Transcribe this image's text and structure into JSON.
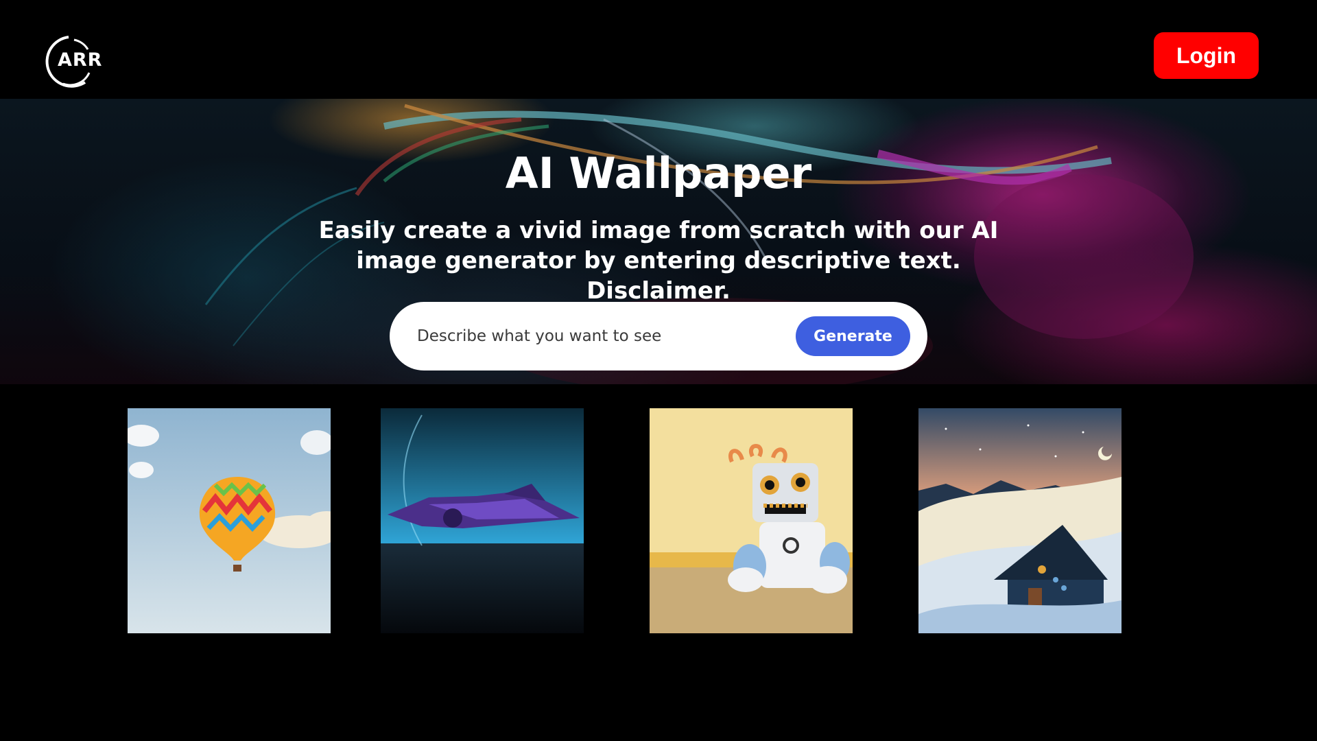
{
  "header": {
    "logo_text": "ARR",
    "login_label": "Login"
  },
  "hero": {
    "title": "AI Wallpaper",
    "subtitle": "Easily create a vivid image from scratch with our AI image generator by entering descriptive text. Disclaimer.",
    "search": {
      "placeholder": "Describe what you want to see",
      "value": ""
    },
    "generate_label": "Generate"
  },
  "colors": {
    "login_button": "#ff0000",
    "generate_button": "#3e5fe0",
    "background": "#000000",
    "text": "#ffffff"
  },
  "gallery": {
    "items": [
      {
        "subject": "hot-air-balloon"
      },
      {
        "subject": "spaceship"
      },
      {
        "subject": "plush-robot"
      },
      {
        "subject": "snowy-cabin"
      }
    ]
  }
}
